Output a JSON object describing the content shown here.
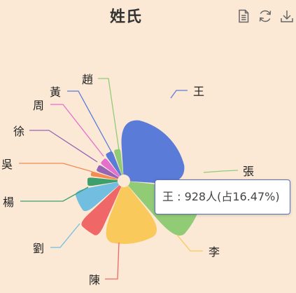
{
  "title": "姓氏",
  "toolbox": {
    "icons": [
      "data-view-icon",
      "refresh-icon",
      "download-icon"
    ]
  },
  "chart_data": {
    "type": "pie",
    "variant": "rose-area",
    "title": "姓氏",
    "series": [
      {
        "name": "王",
        "color": "#5b7bd8"
      },
      {
        "name": "張",
        "color": "#92cb76"
      },
      {
        "name": "李",
        "color": "#f9c95c"
      },
      {
        "name": "陳",
        "color": "#ef6767"
      },
      {
        "name": "劉",
        "color": "#72bee0"
      },
      {
        "name": "楊",
        "color": "#3d9f6c"
      },
      {
        "name": "吳",
        "color": "#f48b50"
      },
      {
        "name": "徐",
        "color": "#9664b5"
      },
      {
        "name": "周",
        "color": "#e56fcd"
      },
      {
        "name": "黃",
        "color": "#5b7bd8"
      },
      {
        "name": "趙",
        "color": "#92cb76"
      }
    ],
    "highlight": {
      "name": "王",
      "value": 928,
      "unit": "人",
      "percent": "16.47%"
    }
  },
  "tooltip": {
    "text": "王 : 928人(占16.47%)"
  }
}
